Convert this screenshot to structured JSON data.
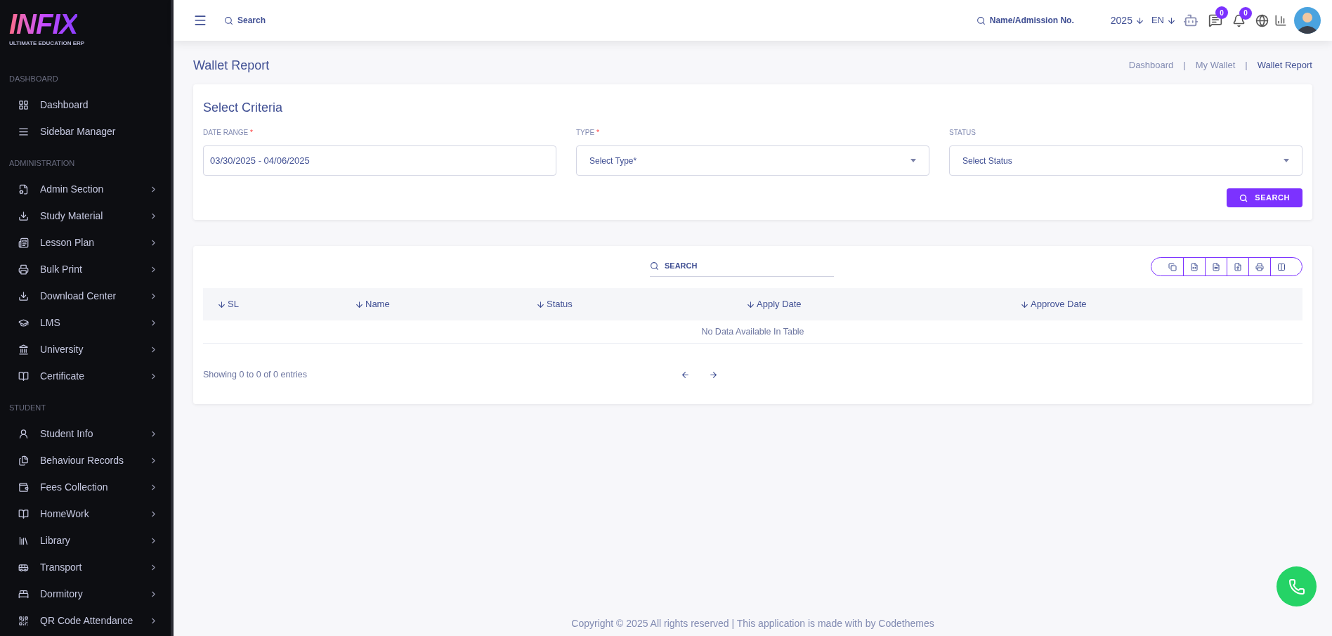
{
  "logo": {
    "name": "INFIX",
    "tagline": "ULTIMATE EDUCATION ERP"
  },
  "sidebar": {
    "sections": [
      {
        "title": "DASHBOARD",
        "items": [
          {
            "label": "Dashboard",
            "expandable": false
          },
          {
            "label": "Sidebar Manager",
            "expandable": false
          }
        ]
      },
      {
        "title": "ADMINISTRATION",
        "items": [
          {
            "label": "Admin Section",
            "expandable": true
          },
          {
            "label": "Study Material",
            "expandable": true
          },
          {
            "label": "Lesson Plan",
            "expandable": true
          },
          {
            "label": "Bulk Print",
            "expandable": true
          },
          {
            "label": "Download Center",
            "expandable": true
          },
          {
            "label": "LMS",
            "expandable": true
          },
          {
            "label": "University",
            "expandable": true
          },
          {
            "label": "Certificate",
            "expandable": true
          }
        ]
      },
      {
        "title": "STUDENT",
        "items": [
          {
            "label": "Student Info",
            "expandable": true
          },
          {
            "label": "Behaviour Records",
            "expandable": true
          },
          {
            "label": "Fees Collection",
            "expandable": true
          },
          {
            "label": "HomeWork",
            "expandable": true
          },
          {
            "label": "Library",
            "expandable": true
          },
          {
            "label": "Transport",
            "expandable": true
          },
          {
            "label": "Dormitory",
            "expandable": true
          },
          {
            "label": "QR Code Attendance",
            "expandable": true
          }
        ]
      }
    ]
  },
  "header": {
    "search_placeholder": "Search",
    "student_search_placeholder": "Name/Admission No.",
    "year": "2025",
    "language": "EN",
    "messages_badge": "0",
    "notifications_badge": "0"
  },
  "page": {
    "title": "Wallet Report",
    "separator": "|",
    "breadcrumb": [
      {
        "label": "Dashboard",
        "current": false
      },
      {
        "label": "My Wallet",
        "current": false
      },
      {
        "label": "Wallet Report",
        "current": true
      }
    ]
  },
  "criteria": {
    "title": "Select Criteria",
    "fields": [
      {
        "kind": "text",
        "label": "DATE RANGE",
        "required_mark": "*",
        "value": "03/30/2025 - 04/06/2025"
      },
      {
        "kind": "select",
        "label": "TYPE",
        "required_mark": "*",
        "placeholder": "Select Type*"
      },
      {
        "kind": "select",
        "label": "STATUS",
        "placeholder": "Select Status"
      }
    ],
    "button": "SEARCH"
  },
  "table": {
    "search_placeholder": "SEARCH",
    "columns": [
      "SL",
      "Name",
      "Status",
      "Apply Date",
      "Approve Date"
    ],
    "empty_message": "No Data Available In Table",
    "info": "Showing 0 to 0 of 0 entries"
  },
  "footer": "Copyright © 2025 All rights reserved | This application is made with by Codethemes"
}
